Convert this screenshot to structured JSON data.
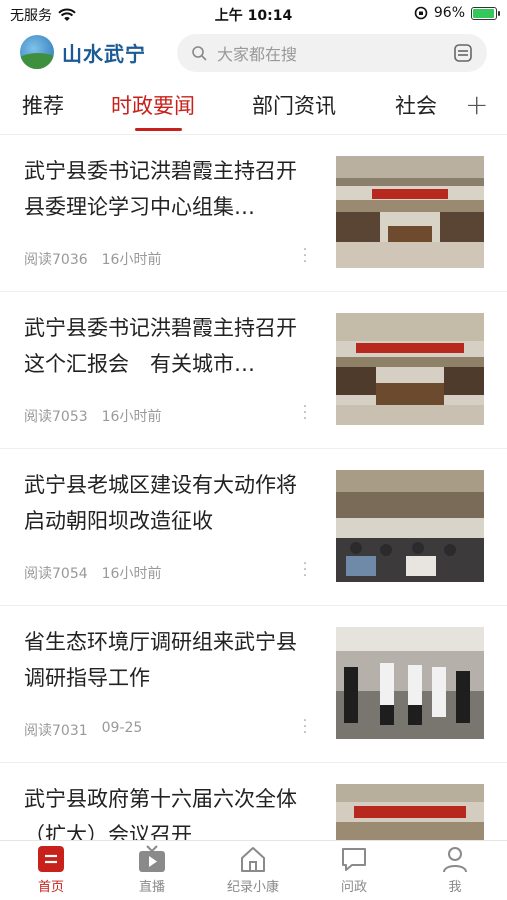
{
  "status_bar": {
    "carrier": "无服务",
    "time": "上午 10:14",
    "battery_percent": "96%",
    "battery_level": 0.96,
    "battery_color": "#34c759"
  },
  "header": {
    "logo_text": "山水武宁",
    "search_placeholder": "大家都在搜"
  },
  "tabs": [
    {
      "label": "推荐",
      "active": false
    },
    {
      "label": "时政要闻",
      "active": true
    },
    {
      "label": "部门资讯",
      "active": false
    },
    {
      "label": "社会",
      "active": false
    }
  ],
  "accent_color": "#c8211b",
  "news": [
    {
      "title": "武宁县委书记洪碧霞主持召开县委理论学习中心组集…",
      "reads": "阅读7036",
      "time": "16小时前"
    },
    {
      "title": "武宁县委书记洪碧霞主持召开这个汇报会　有关城市…",
      "reads": "阅读7053",
      "time": "16小时前"
    },
    {
      "title": "武宁县老城区建设有大动作将启动朝阳坝改造征收",
      "reads": "阅读7054",
      "time": "16小时前"
    },
    {
      "title": "省生态环境厅调研组来武宁县调研指导工作",
      "reads": "阅读7031",
      "time": "09-25"
    },
    {
      "title": "武宁县政府第十六届六次全体（扩大）会议召开",
      "reads": "",
      "time": ""
    }
  ],
  "bottom_nav": [
    {
      "label": "首页",
      "icon": "home-news-icon",
      "active": true
    },
    {
      "label": "直播",
      "icon": "tv-icon",
      "active": false
    },
    {
      "label": "纪录小康",
      "icon": "house-icon",
      "active": false
    },
    {
      "label": "问政",
      "icon": "chat-icon",
      "active": false
    },
    {
      "label": "我",
      "icon": "user-icon",
      "active": false
    }
  ]
}
